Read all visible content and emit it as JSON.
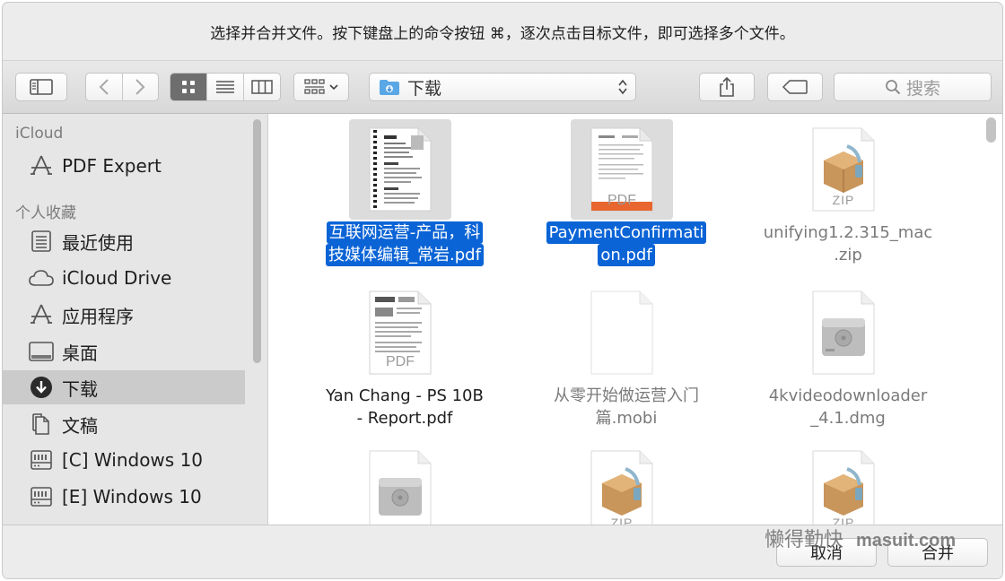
{
  "message": "选择并合并文件。按下键盘上的命令按钮 ⌘，逐次点击目标文件，即可选择多个文件。",
  "toolbar": {
    "location": "下载",
    "search_placeholder": "搜索",
    "view_mode": "icon",
    "icons": [
      "sidebar-toggle-icon",
      "back-icon",
      "forward-icon",
      "icon-view-icon",
      "list-view-icon",
      "column-view-icon",
      "group-icon",
      "folder-icon",
      "up-down-chevron-icon",
      "share-icon",
      "tag-icon",
      "search-icon"
    ]
  },
  "sidebar": {
    "sections": [
      {
        "title": "iCloud",
        "items": [
          {
            "label": "PDF Expert",
            "icon": "app-store-icon",
            "selected": false
          }
        ]
      },
      {
        "title": "个人收藏",
        "items": [
          {
            "label": "最近使用",
            "icon": "recents-icon",
            "selected": false
          },
          {
            "label": "iCloud Drive",
            "icon": "cloud-icon",
            "selected": false
          },
          {
            "label": "应用程序",
            "icon": "applications-icon",
            "selected": false
          },
          {
            "label": "桌面",
            "icon": "desktop-icon",
            "selected": false
          },
          {
            "label": "下载",
            "icon": "downloads-icon",
            "selected": true
          },
          {
            "label": "文稿",
            "icon": "documents-icon",
            "selected": false
          },
          {
            "label": "[C] Windows 10",
            "icon": "drive-icon",
            "selected": false
          },
          {
            "label": "[E] Windows 10",
            "icon": "drive-icon",
            "selected": false
          }
        ]
      }
    ]
  },
  "files": [
    {
      "name_lines": [
        "互联网运营-产品，科",
        "技媒体编辑_常岩.pdf"
      ],
      "icon": "pdf-resume-icon",
      "selected": true,
      "dim": false
    },
    {
      "name_lines": [
        "PaymentConfirmati",
        "on.pdf"
      ],
      "icon": "pdf-document-icon",
      "selected": true,
      "dim": false,
      "thumb_label": "PDF"
    },
    {
      "name_lines": [
        "unifying1.2.315_mac",
        ".zip"
      ],
      "icon": "zip-archive-icon",
      "selected": false,
      "dim": true,
      "thumb_label": "ZIP"
    },
    {
      "name_lines": [
        "Yan Chang - PS 10B",
        "- Report.pdf"
      ],
      "icon": "pdf-report-icon",
      "selected": false,
      "dim": false,
      "thumb_label": "PDF"
    },
    {
      "name_lines": [
        "从零开始做运营入门",
        "篇.mobi"
      ],
      "icon": "blank-document-icon",
      "selected": false,
      "dim": true
    },
    {
      "name_lines": [
        "4kvideodownloader",
        "_4.1.dmg"
      ],
      "icon": "disk-image-icon",
      "selected": false,
      "dim": true
    },
    {
      "name_lines": [],
      "icon": "disk-image-icon",
      "selected": false,
      "dim": true
    },
    {
      "name_lines": [],
      "icon": "zip-archive-icon",
      "selected": false,
      "dim": true,
      "thumb_label": "ZIP"
    },
    {
      "name_lines": [],
      "icon": "zip-archive-icon",
      "selected": false,
      "dim": true,
      "thumb_label": "ZIP"
    }
  ],
  "buttons": {
    "cancel": "取消",
    "merge": "合并"
  },
  "watermark": {
    "text": "懒得勤快",
    "domain": "masuit.com"
  },
  "colors": {
    "selection": "#0b64d6",
    "sidebar_bg": "#e6e6e6",
    "window_bg": "#ececec"
  }
}
